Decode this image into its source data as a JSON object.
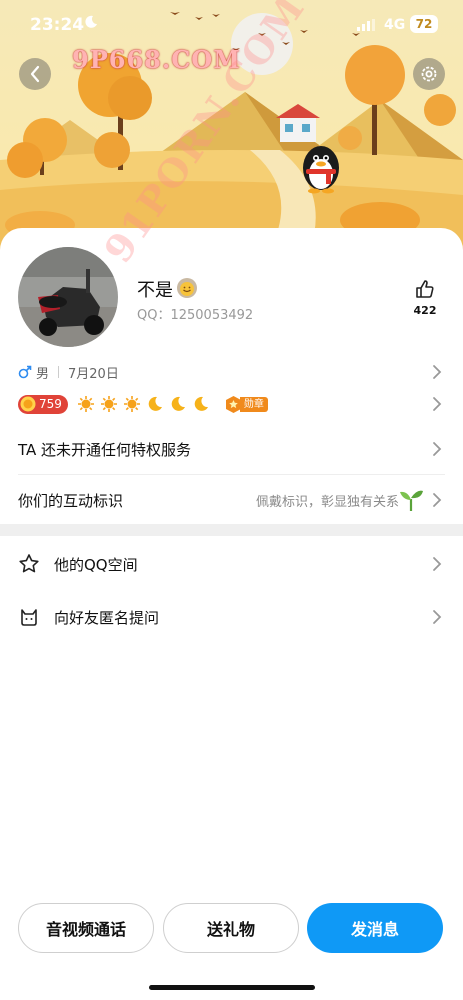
{
  "status_bar": {
    "time": "23:24",
    "network": "4G",
    "battery": "72"
  },
  "header": {
    "watermark": "9P668.COM",
    "diagonal_watermark": "91PORN.COM"
  },
  "profile": {
    "nickname": "不是",
    "qq_number": "QQ：1250053492",
    "likes": "422",
    "gender_icon": "male-symbol-icon",
    "gender": "男",
    "birthday": "7月20日",
    "level": "759",
    "medal_label": "勋章"
  },
  "rows": {
    "privilege": "TA 还未开通任何特权服务",
    "interaction_label": "你们的互动标识",
    "interaction_hint": "佩戴标识，彰显独有关系"
  },
  "list": {
    "qzone": "他的QQ空间",
    "anon_ask": "向好友匿名提问"
  },
  "buttons": {
    "call": "音视频通话",
    "gift": "送礼物",
    "message": "发消息"
  },
  "colors": {
    "primary": "#0f99f6",
    "level_pill": "#e04338",
    "medal": "#f08a1c"
  }
}
